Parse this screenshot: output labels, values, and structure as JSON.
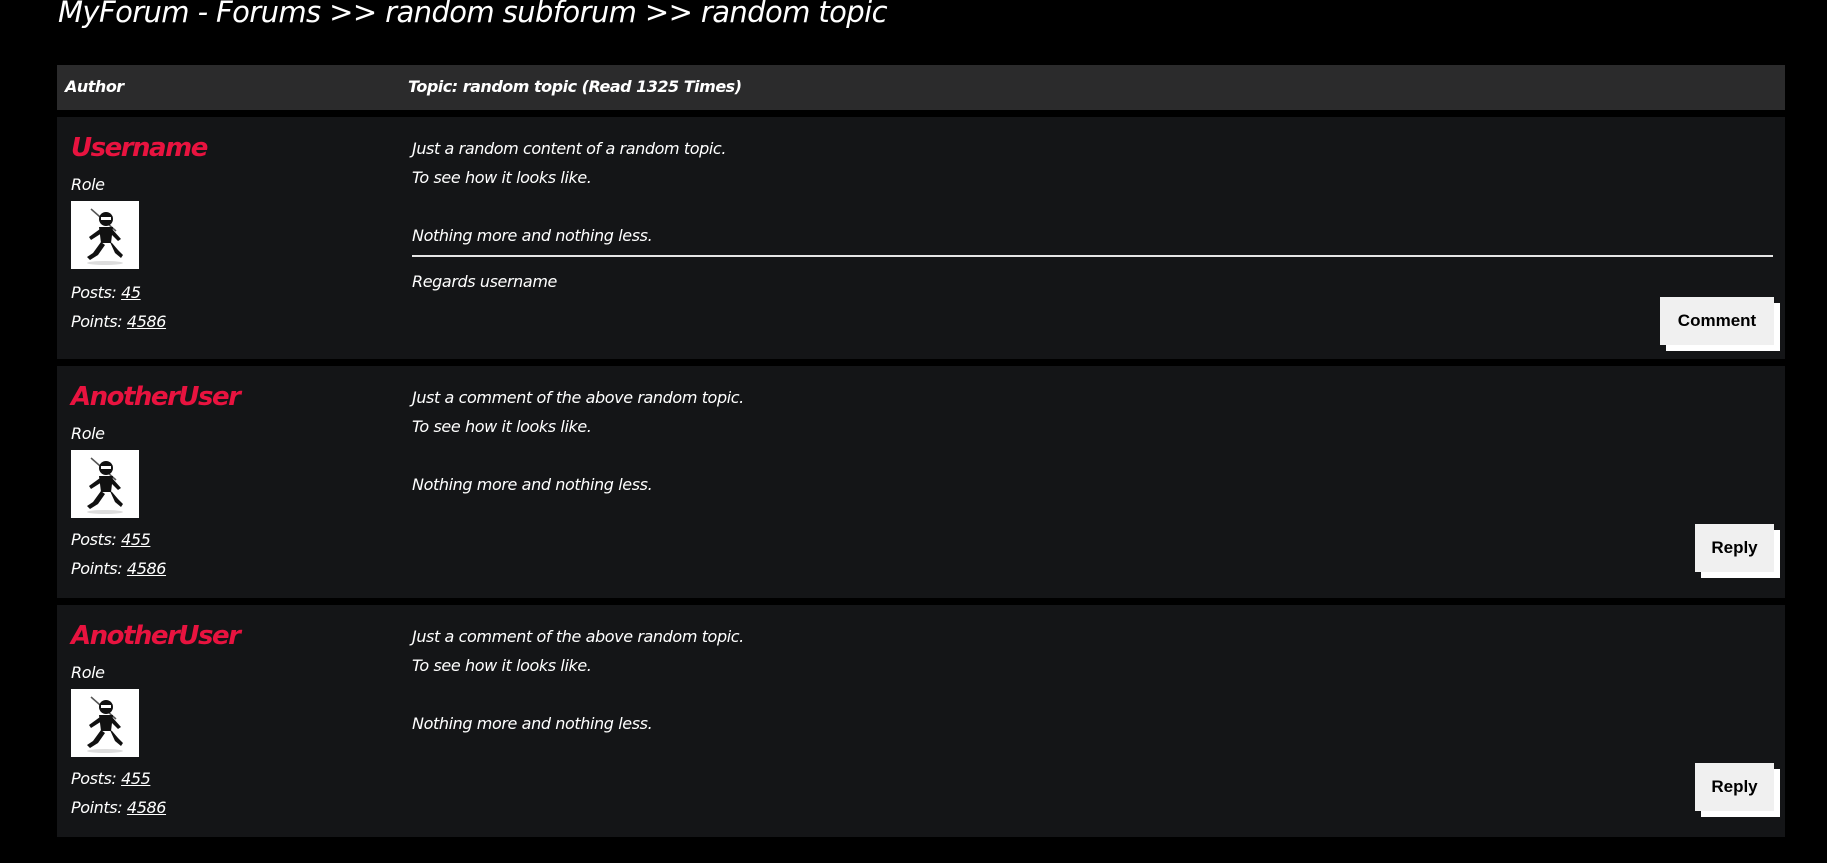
{
  "page": {
    "title": "MyForum - Forums >> random subforum >> random topic"
  },
  "table_header": {
    "author": "Author",
    "topic": "Topic: random topic (Read 1325 Times)"
  },
  "posts": [
    {
      "username": "Username",
      "role": "Role",
      "posts_label": "Posts:",
      "posts_count": "45",
      "points_label": "Points:",
      "points_count": "4586",
      "lines": [
        "Just a random content of a random topic.",
        "To see how it looks like.",
        "",
        "Nothing more and nothing less."
      ],
      "signature": "Regards username",
      "button_label": "Comment",
      "avatar_icon": "ninja-avatar-icon"
    },
    {
      "username": "AnotherUser",
      "role": "Role",
      "posts_label": "Posts:",
      "posts_count": "455",
      "points_label": "Points:",
      "points_count": "4586",
      "lines": [
        "Just a comment of the above random topic.",
        "To see how it looks like.",
        "",
        "Nothing more and nothing less."
      ],
      "button_label": "Reply",
      "avatar_icon": "ninja-avatar-icon"
    },
    {
      "username": "AnotherUser",
      "role": "Role",
      "posts_label": "Posts:",
      "posts_count": "455",
      "points_label": "Points:",
      "points_count": "4586",
      "lines": [
        "Just a comment of the above random topic.",
        "To see how it looks like.",
        "",
        "Nothing more and nothing less."
      ],
      "button_label": "Reply",
      "avatar_icon": "ninja-avatar-icon"
    }
  ],
  "colors": {
    "background": "#000000",
    "header_bg": "#2b2b2c",
    "post_bg": "#141517",
    "username": "#e8133f",
    "text": "#ffffff",
    "button_bg": "#f0f0f0"
  }
}
